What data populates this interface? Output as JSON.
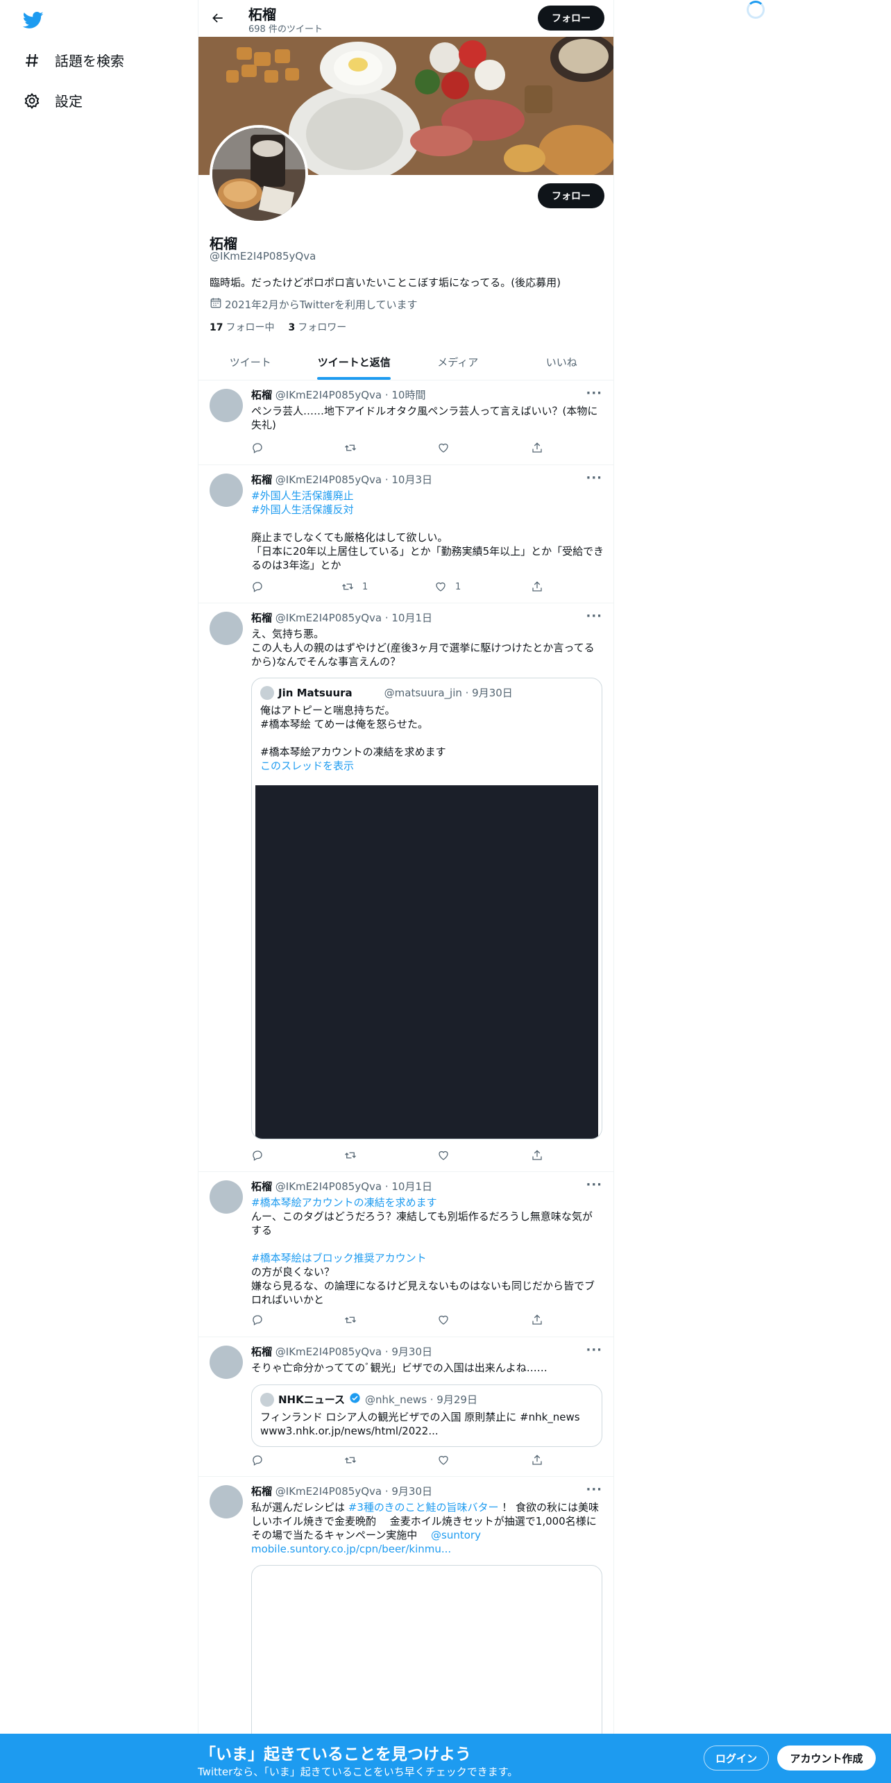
{
  "nav": {
    "explore_label": "話題を検索",
    "settings_label": "設定"
  },
  "header": {
    "name": "柘榴",
    "tweet_count": "698 件のツイート",
    "follow_label": "フォロー"
  },
  "profile": {
    "name": "柘榴",
    "handle": "@IKmE2I4P085yQva",
    "bio": "臨時垢。だったけどポロポロ言いたいことこぼす垢になってる。(後応募用)",
    "joined": "2021年2月からTwitterを利用しています",
    "following_count": "17",
    "following_label": "フォロー中",
    "followers_count": "3",
    "followers_label": "フォロワー",
    "follow_label": "フォロー"
  },
  "tabs": [
    {
      "label": "ツイート"
    },
    {
      "label": "ツイートと返信"
    },
    {
      "label": "メディア"
    },
    {
      "label": "いいね"
    }
  ],
  "tweets": [
    {
      "name": "柘榴",
      "handle_time": "@IKmE2I4P085yQva · 10時間",
      "text": "ペンラ芸人……地下アイドルオタク風ペンラ芸人って言えばいい？(本物に\n失礼)"
    },
    {
      "name": "柘榴",
      "handle_time": "@IKmE2I4P085yQva · 10月3日",
      "tag1": "#外国人生活保護廃止",
      "tag2": "#外国人生活保護反対",
      "text": "廃止までしなくても厳格化はして欲しい。\n「日本に20年以上居住している」とか「勤務実績5年以上」とか「受給でき\nるのは3年迄」とか",
      "retweets": "1",
      "likes": "1"
    },
    {
      "name": "柘榴",
      "handle_time": "@IKmE2I4P085yQva · 10月1日",
      "text": "え、気持ち悪。\nこの人も人の親のはずやけど(産後3ヶ月で選挙に駆けつけたとか言ってる\nから)なんでそんな事言えんの？",
      "quote": {
        "name": "Jin Matsuura",
        "handle_time": "@matsuura_jin · 9月30日",
        "text": "俺はアトピーと喘息持ちだ。\n#橋本琴絵 てめーは俺を怒らせた。\n\n#橋本琴絵アカウントの凍結を求めます",
        "thread_link": "このスレッドを表示"
      }
    },
    {
      "name": "柘榴",
      "handle_time": "@IKmE2I4P085yQva · 10月1日",
      "tag1": "#橋本琴絵アカウントの凍結を求めます",
      "text1": "んー、このタグはどうだろう？凍結しても別垢作るだろうし無意味な気が\nする",
      "tag2": "#橋本琴絵はブロック推奨アカウント",
      "text2": "の方が良くない？\n嫌なら見るな、の論理になるけど見えないものはないも同じだから皆でブ\nロればいいかと"
    },
    {
      "name": "柘榴",
      "handle_time": "@IKmE2I4P085yQva · 9月30日",
      "text": "そりゃ亡命分かっててのﾞ観光」ビザでの入国は出来んよね……",
      "quote": {
        "name": "NHKニュース",
        "handle_time": "@nhk_news · 9月29日",
        "text": "フィンランド ロシア人の観光ビザでの入国 原則禁止に #nhk_news\nwww3.nhk.or.jp/news/html/2022..."
      }
    },
    {
      "name": "柘榴",
      "handle_time": "@IKmE2I4P085yQva · 9月30日",
      "text_a": "私が選んだレシピは ",
      "tag": "#3種のきのこと鮭の旨味バター",
      "text_b": " ！ 食欲の秋には美味\nしいホイル焼きで金麦晩酌　 金麦ホイル焼きセットが抽選で1,000名様に\nその場で当たるキャンペーン実施中　 ",
      "mention": "@suntory",
      "url": "mobile.suntory.co.jp/cpn/beer/kinmu..."
    }
  ],
  "bottombar": {
    "title": "「いま」起きていることを見つけよう",
    "subtitle": "Twitterなら、「いま」起きていることをいち早くチェックできます。",
    "login_label": "ログイン",
    "signup_label": "アカウント作成"
  },
  "colors": {
    "accent": "#1d9bf0",
    "text": "#0f1419",
    "muted": "#536471",
    "media_dark": "#1b1f29"
  }
}
